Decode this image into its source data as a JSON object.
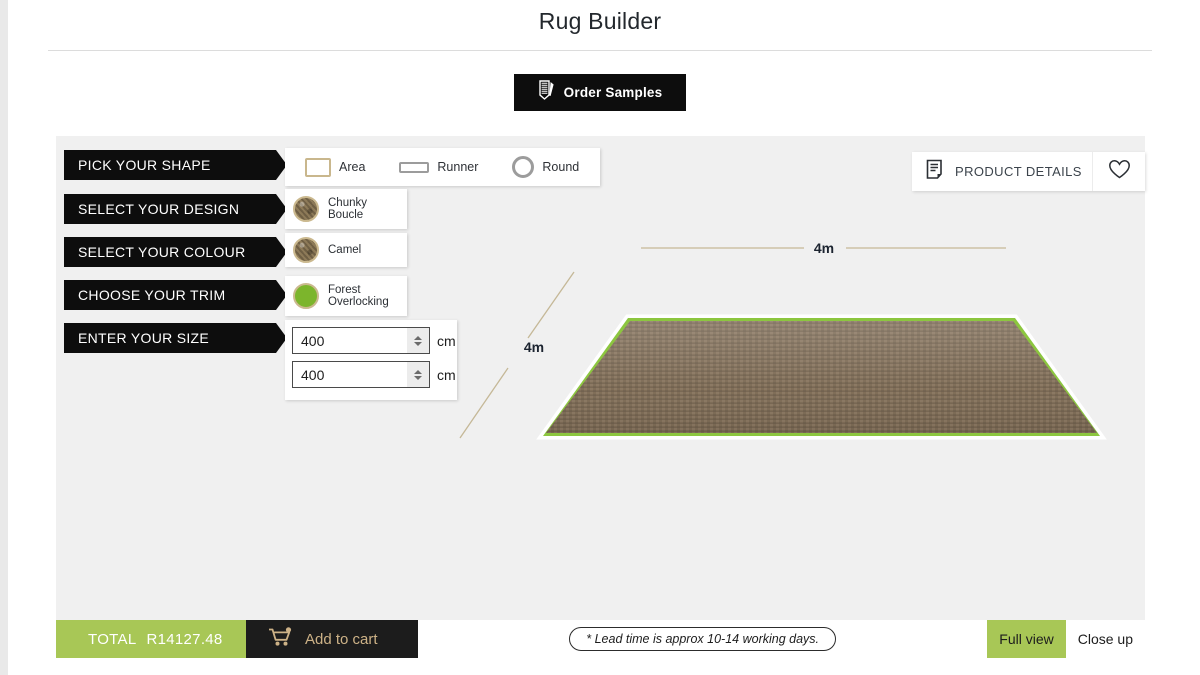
{
  "header": {
    "title": "Rug Builder",
    "order_samples_label": "Order Samples",
    "order_samples_icon": "rug-sample-icon"
  },
  "steps": [
    {
      "key": "shape",
      "label": "PICK YOUR SHAPE"
    },
    {
      "key": "design",
      "label": "SELECT YOUR DESIGN"
    },
    {
      "key": "colour",
      "label": "SELECT YOUR COLOUR"
    },
    {
      "key": "trim",
      "label": "CHOOSE YOUR TRIM"
    },
    {
      "key": "size",
      "label": "ENTER YOUR SIZE"
    }
  ],
  "shape_options": [
    {
      "label": "Area",
      "icon": "rectangle-icon",
      "selected": true
    },
    {
      "label": "Runner",
      "icon": "runner-rectangle-icon",
      "selected": false
    },
    {
      "label": "Round",
      "icon": "circle-icon",
      "selected": false
    }
  ],
  "selections": {
    "design": {
      "label": "Chunky Boucle",
      "line1": "Chunky",
      "line2": "Boucle",
      "swatch": "brown-textured"
    },
    "colour": {
      "label": "Camel",
      "line1": "Camel",
      "line2": "",
      "swatch": "brown-textured"
    },
    "trim": {
      "label": "Forest Overlocking",
      "line1": "Forest",
      "line2": "Overlocking",
      "swatch": "green"
    }
  },
  "size": {
    "width_value": "400",
    "length_value": "400",
    "unit": "cm"
  },
  "product_details": {
    "label": "PRODUCT DETAILS",
    "icon": "document-icon",
    "wishlist_icon": "heart-icon"
  },
  "preview": {
    "top_dimension": "4m",
    "side_dimension": "4m",
    "rug_color": "#7d6b55",
    "trim_color": "#8cc63f",
    "dimension_line_color": "#c5b897"
  },
  "footer": {
    "total_label": "TOTAL",
    "total_value": "R14127.48",
    "add_to_cart_label": "Add to cart",
    "cart_icon": "shopping-cart-icon",
    "lead_time_note": "* Lead time is approx 10-14 working days.",
    "view_buttons": [
      {
        "label": "Full view",
        "active": true
      },
      {
        "label": "Close up",
        "active": false
      }
    ]
  },
  "colors": {
    "accent_green": "#a8c756",
    "black": "#0d0d0d",
    "gold": "#cdb287",
    "panel_grey": "#f0f0f0"
  }
}
